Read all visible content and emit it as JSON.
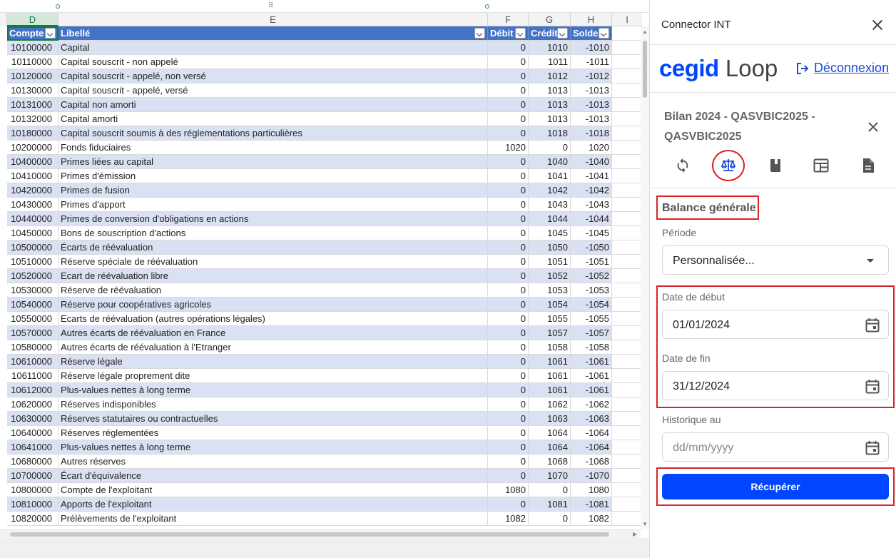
{
  "sheet": {
    "columns": [
      "D",
      "E",
      "F",
      "G",
      "H",
      "I"
    ],
    "selected_column": "D",
    "headers": [
      "Compte",
      "Libellé",
      "Débit",
      "Crédit",
      "Solde"
    ],
    "rows": [
      [
        "10100000",
        "Capital",
        "0",
        "1010",
        "-1010"
      ],
      [
        "10110000",
        "Capital souscrit - non appelé",
        "0",
        "1011",
        "-1011"
      ],
      [
        "10120000",
        "Capital souscrit - appelé, non versé",
        "0",
        "1012",
        "-1012"
      ],
      [
        "10130000",
        "Capital souscrit - appelé, versé",
        "0",
        "1013",
        "-1013"
      ],
      [
        "10131000",
        "Capital non amorti",
        "0",
        "1013",
        "-1013"
      ],
      [
        "10132000",
        "Capital amorti",
        "0",
        "1013",
        "-1013"
      ],
      [
        "10180000",
        "Capital souscrit soumis à des réglementations particulières",
        "0",
        "1018",
        "-1018"
      ],
      [
        "10200000",
        "Fonds fiduciaires",
        "1020",
        "0",
        "1020"
      ],
      [
        "10400000",
        "Primes liées au capital",
        "0",
        "1040",
        "-1040"
      ],
      [
        "10410000",
        "Primes d'émission",
        "0",
        "1041",
        "-1041"
      ],
      [
        "10420000",
        "Primes de fusion",
        "0",
        "1042",
        "-1042"
      ],
      [
        "10430000",
        "Primes d'apport",
        "0",
        "1043",
        "-1043"
      ],
      [
        "10440000",
        "Primes de conversion d'obligations en actions",
        "0",
        "1044",
        "-1044"
      ],
      [
        "10450000",
        "Bons de souscription d'actions",
        "0",
        "1045",
        "-1045"
      ],
      [
        "10500000",
        "Écarts de réévaluation",
        "0",
        "1050",
        "-1050"
      ],
      [
        "10510000",
        "Réserve spéciale de réévaluation",
        "0",
        "1051",
        "-1051"
      ],
      [
        "10520000",
        "Ecart de réévaluation libre",
        "0",
        "1052",
        "-1052"
      ],
      [
        "10530000",
        "Réserve de réévaluation",
        "0",
        "1053",
        "-1053"
      ],
      [
        "10540000",
        "Réserve pour coopératives agricoles",
        "0",
        "1054",
        "-1054"
      ],
      [
        "10550000",
        "Ecarts de réévaluation (autres opérations légales)",
        "0",
        "1055",
        "-1055"
      ],
      [
        "10570000",
        "Autres écarts de réévaluation en France",
        "0",
        "1057",
        "-1057"
      ],
      [
        "10580000",
        "Autres écarts de réévaluation à l'Etranger",
        "0",
        "1058",
        "-1058"
      ],
      [
        "10610000",
        "Réserve légale",
        "0",
        "1061",
        "-1061"
      ],
      [
        "10611000",
        "Réserve légale proprement dite",
        "0",
        "1061",
        "-1061"
      ],
      [
        "10612000",
        "Plus-values nettes à long terme",
        "0",
        "1061",
        "-1061"
      ],
      [
        "10620000",
        "Réserves indisponibles",
        "0",
        "1062",
        "-1062"
      ],
      [
        "10630000",
        "Réserves statutaires ou contractuelles",
        "0",
        "1063",
        "-1063"
      ],
      [
        "10640000",
        "Réserves réglementées",
        "0",
        "1064",
        "-1064"
      ],
      [
        "10641000",
        "Plus-values nettes à long terme",
        "0",
        "1064",
        "-1064"
      ],
      [
        "10680000",
        "Autres réserves",
        "0",
        "1068",
        "-1068"
      ],
      [
        "10700000",
        "Écart d'équivalence",
        "0",
        "1070",
        "-1070"
      ],
      [
        "10800000",
        "Compte de l'exploitant",
        "1080",
        "0",
        "1080"
      ],
      [
        "10810000",
        "Apports de l'exploitant",
        "0",
        "1081",
        "-1081"
      ],
      [
        "10820000",
        "Prélèvements de l'exploitant",
        "1082",
        "0",
        "1082"
      ]
    ]
  },
  "pane": {
    "title": "Connector INT",
    "logo": {
      "word1": "cegid",
      "word2": "Loop"
    },
    "logout_label": "Déconnexion",
    "dossier_title": "Bilan 2024 - QASVBIC2025 - QASVBIC2025",
    "toolbar": [
      {
        "name": "sync-icon",
        "active": false
      },
      {
        "name": "balance-scale-icon",
        "active": true
      },
      {
        "name": "book-icon",
        "active": false
      },
      {
        "name": "table-icon",
        "active": false
      },
      {
        "name": "document-icon",
        "active": false
      }
    ],
    "section_title": "Balance générale",
    "period_label": "Période",
    "period_value": "Personnalisée...",
    "start_label": "Date de début",
    "start_value": "01/01/2024",
    "end_label": "Date de fin",
    "end_value": "31/12/2024",
    "history_label": "Historique au",
    "history_placeholder": "dd/mm/yyyy",
    "submit_label": "Récupérer"
  },
  "colors": {
    "header_blue": "#4472c4",
    "band_blue": "#d9e1f2",
    "brand_blue": "#0046fe",
    "highlight_red": "#d8232a"
  }
}
